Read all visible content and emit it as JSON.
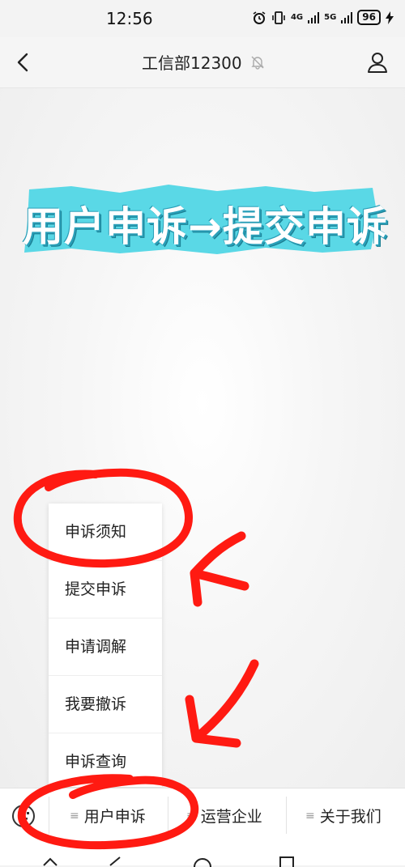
{
  "status_bar": {
    "time": "12:56",
    "signal_4g": "4G",
    "signal_5g": "5G",
    "battery": "96"
  },
  "title_bar": {
    "title": "工信部12300"
  },
  "banner": {
    "text": "用户申诉→提交申诉",
    "color": "#5ad8e6"
  },
  "popup_menu": {
    "items": [
      "申诉须知",
      "提交申诉",
      "申请调解",
      "我要撤诉",
      "申诉查询"
    ]
  },
  "bottom_nav": {
    "items": [
      "用户申诉",
      "运营企业",
      "关于我们"
    ]
  },
  "annotation_color": "#ff1a12"
}
